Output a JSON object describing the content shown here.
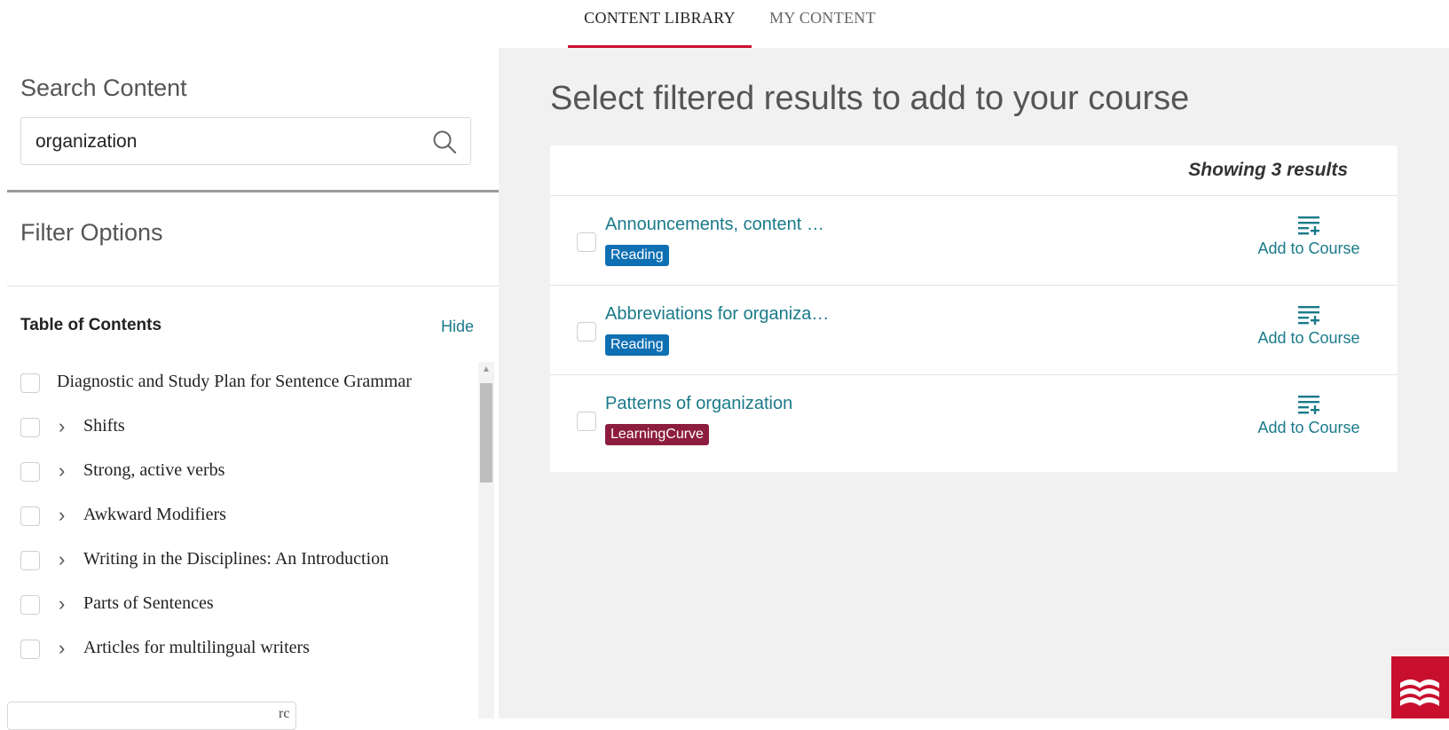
{
  "tabs": [
    {
      "label": "CONTENT LIBRARY",
      "active": true
    },
    {
      "label": "MY CONTENT",
      "active": false
    }
  ],
  "search": {
    "label": "Search Content",
    "value": "organization",
    "icon": "search-icon"
  },
  "filter": {
    "label": "Filter Options",
    "toc_title": "Table of Contents",
    "toc_hide": "Hide",
    "items": [
      {
        "label": "Diagnostic and Study Plan for Sentence Grammar",
        "expandable": false
      },
      {
        "label": "Shifts",
        "expandable": true
      },
      {
        "label": "Strong, active verbs",
        "expandable": true
      },
      {
        "label": "Awkward Modifiers",
        "expandable": true
      },
      {
        "label": "Writing in the Disciplines: An Introduction",
        "expandable": true
      },
      {
        "label": "Parts of Sentences",
        "expandable": true
      },
      {
        "label": "Articles for multilingual writers",
        "expandable": true
      }
    ],
    "partial_text": "rc"
  },
  "main": {
    "title": "Select filtered results to add to your course",
    "showing": "Showing 3 results",
    "results": [
      {
        "title": "Announcements, content …",
        "badge": "Reading",
        "add": "Add to Course"
      },
      {
        "title": "Abbreviations for organiza…",
        "badge": "Reading",
        "add": "Add to Course"
      },
      {
        "title": "Patterns of organization",
        "badge": "LearningCurve",
        "add": "Add to Course"
      }
    ]
  },
  "colors": {
    "accent": "#c8102e",
    "link": "#1a7a8a",
    "reading_badge": "#0f6fb3",
    "learningcurve_badge": "#8c1d3f"
  }
}
